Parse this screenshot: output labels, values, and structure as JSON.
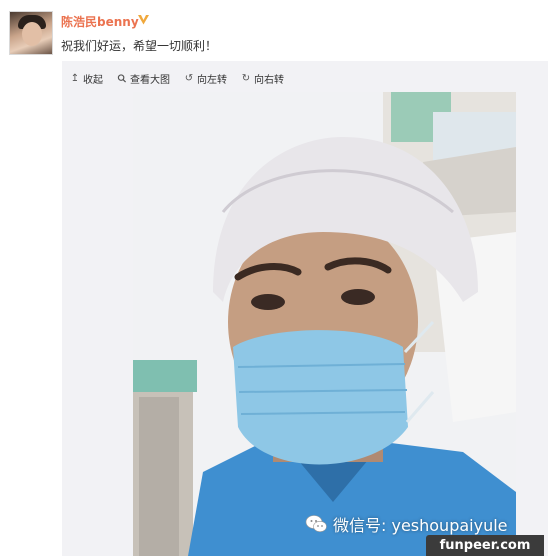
{
  "post": {
    "author": "陈浩民benny",
    "vip_icon": "vip-badge-icon",
    "text": "祝我们好运，希望一切顺利！"
  },
  "toolbar": {
    "collapse_icon": "arrow-up-icon",
    "collapse_label": "收起",
    "view_large_icon": "search-icon",
    "view_large_label": "查看大图",
    "rotate_left_icon": "rotate-left-icon",
    "rotate_left_label": "向左转",
    "rotate_right_icon": "rotate-right-icon",
    "rotate_right_label": "向右转"
  },
  "watermark": {
    "icon": "wechat-icon",
    "text": "微信号: yeshoupaiyule"
  },
  "site_badge": "funpeer.com",
  "colors": {
    "author": "#eb7350",
    "panel_bg": "#f2f2f5",
    "scrubs": "#3f8fd0",
    "mask": "#8ec7e6"
  }
}
